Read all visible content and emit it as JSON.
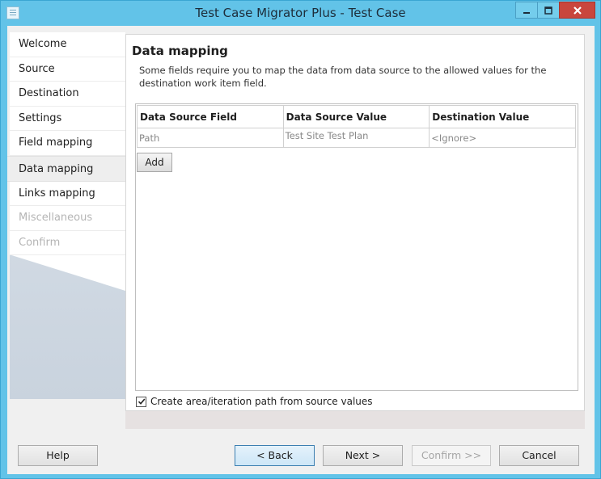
{
  "window": {
    "title": "Test Case Migrator Plus - Test Case"
  },
  "sidebar": {
    "items": [
      {
        "label": "Welcome",
        "state": "normal"
      },
      {
        "label": "Source",
        "state": "normal"
      },
      {
        "label": "Destination",
        "state": "normal"
      },
      {
        "label": "Settings",
        "state": "normal"
      },
      {
        "label": "Field mapping",
        "state": "normal"
      },
      {
        "label": "Data mapping",
        "state": "active"
      },
      {
        "label": "Links mapping",
        "state": "normal"
      },
      {
        "label": "Miscellaneous",
        "state": "disabled"
      },
      {
        "label": "Confirm",
        "state": "disabled"
      }
    ]
  },
  "main": {
    "title": "Data mapping",
    "description": "Some fields require you to map the data from data source to the allowed values for the destination work item field.",
    "grid": {
      "headers": [
        "Data Source Field",
        "Data Source Value",
        "Destination Value"
      ],
      "rows": [
        [
          "Path",
          "Test Site Test Plan",
          "<Ignore>"
        ]
      ]
    },
    "add_label": "Add",
    "checkbox": {
      "label": "Create area/iteration path from source values",
      "checked": true
    }
  },
  "footer": {
    "help": "Help",
    "back": "< Back",
    "next": "Next >",
    "confirm": "Confirm >>",
    "cancel": "Cancel"
  },
  "colors": {
    "titlebar": "#62c3e8",
    "close_button": "#c9463d",
    "focused_button_border": "#3c7fb1"
  },
  "icons": {
    "app": "application-icon",
    "minimize": "minimize-icon",
    "maximize": "maximize-icon",
    "close": "close-icon",
    "check": "checkmark-icon"
  }
}
